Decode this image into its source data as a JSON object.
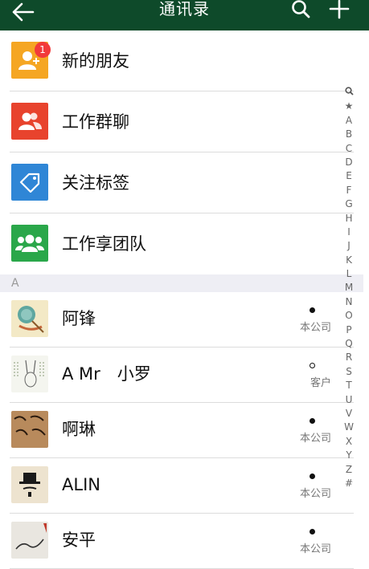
{
  "header": {
    "title": "通讯录",
    "back_icon": "arrow-left-icon",
    "search_icon": "search-icon",
    "add_icon": "plus-icon",
    "bg": "#0e4a2a"
  },
  "functions": [
    {
      "label": "新的朋友",
      "icon": "add-friend-icon",
      "color": "#f5a623",
      "badge": "1"
    },
    {
      "label": "工作群聊",
      "icon": "group-chat-icon",
      "color": "#e8432d"
    },
    {
      "label": "关注标签",
      "icon": "tag-icon",
      "color": "#2f86d6"
    },
    {
      "label": "工作享团队",
      "icon": "team-icon",
      "color": "#2aa74a"
    }
  ],
  "section_letter": "A",
  "contacts": [
    {
      "name": "阿锋",
      "tag": "本公司",
      "dot": "filled"
    },
    {
      "name": "A Mr　小罗",
      "tag": "客户",
      "dot": "hollow"
    },
    {
      "name": "啊琳",
      "tag": "本公司",
      "dot": "filled"
    },
    {
      "name": "ALIN",
      "tag": "本公司",
      "dot": "filled"
    },
    {
      "name": "安平",
      "tag": "本公司",
      "dot": "filled"
    }
  ],
  "index": [
    "🔍",
    "★",
    "A",
    "B",
    "C",
    "D",
    "E",
    "F",
    "G",
    "H",
    "I",
    "J",
    "K",
    "L",
    "M",
    "N",
    "O",
    "P",
    "Q",
    "R",
    "S",
    "T",
    "U",
    "V",
    "W",
    "X",
    "Y",
    "Z",
    "#"
  ]
}
